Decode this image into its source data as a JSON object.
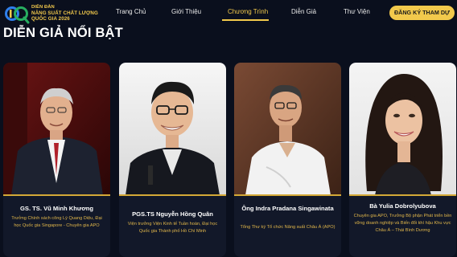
{
  "brand": {
    "line1": "DIỄN ĐÀN",
    "line2": "NĂNG SUẤT CHẤT LƯỢNG",
    "line3": "QUỐC GIA 2026",
    "logo_letters": "PQ"
  },
  "nav": {
    "items": [
      {
        "label": "Trang Chủ"
      },
      {
        "label": "Giới Thiệu"
      },
      {
        "label": "Chương Trình"
      },
      {
        "label": "Diễn Giả"
      },
      {
        "label": "Thư Viện"
      }
    ],
    "active_index": 2,
    "cta_label": "ĐĂNG KÝ THAM DỰ"
  },
  "section": {
    "title": "DIỄN GIẢ NỔI BẬT"
  },
  "speakers": [
    {
      "name": "GS. TS. Vũ Minh Khương",
      "desc": "Trưởng Chính sách công Lý Quang Diệu, Đại học Quốc gia Singapore - Chuyên gia APO"
    },
    {
      "name": "PGS.TS Nguyễn Hồng Quân",
      "desc": "Viện trưởng Viện Kinh tế Tuần hoàn, Đại học Quốc gia Thành phố Hồ Chí Minh"
    },
    {
      "name": "Ông Indra Pradana Singawinata",
      "desc": "Tổng Thư ký Tổ chức Năng suất Châu Á (APO)"
    },
    {
      "name": "Bà Yulia Dobrolyubova",
      "desc": "Chuyên gia APO, Trưởng Bộ phận Phát triển bền vững doanh nghiệp và Biến đổi khí hậu Khu vực Châu Á – Thái Bình Dương"
    }
  ],
  "colors": {
    "background": "#0a0f1d",
    "accent": "#f2c94c",
    "card": "#121829",
    "desc_text": "#e0b64a"
  }
}
